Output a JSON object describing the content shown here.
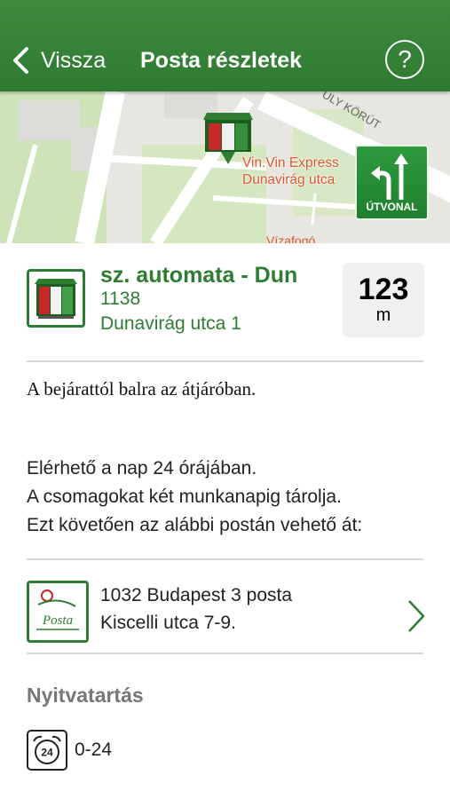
{
  "header": {
    "back_label": "Vissza",
    "title": "Posta részletek",
    "help_label": "?"
  },
  "map": {
    "street_label": "ULY KÖRÚT",
    "pin_label_line1": "Vin.Vin Express",
    "pin_label_line2": "Dunavirág utca",
    "partial_label": "Vízafogó",
    "route_button_label": "ÚTVONAL"
  },
  "location": {
    "name": "sz. automata - Dun",
    "zip": "1138",
    "address": "Dunavirág utca 1",
    "distance_value": "123",
    "distance_unit": "m"
  },
  "directions_text": "A bejárattól balra az átjáróban.",
  "info_lines": [
    "Elérhető a nap 24 órájában.",
    "A csomagokat két munkanapig tárolja.",
    "Ezt követően az alábbi postán vehető át:"
  ],
  "post_office": {
    "logo_text": "Posta",
    "name": "1032 Budapest 3 posta",
    "address": "Kiscelli utca  7-9."
  },
  "opening_hours": {
    "title": "Nyitvatartás",
    "icon_text": "24",
    "value": "0-24"
  },
  "colors": {
    "header_green": "#2f7a32",
    "accent_green": "#2e7d32",
    "map_label_orange": "#e0562b"
  }
}
